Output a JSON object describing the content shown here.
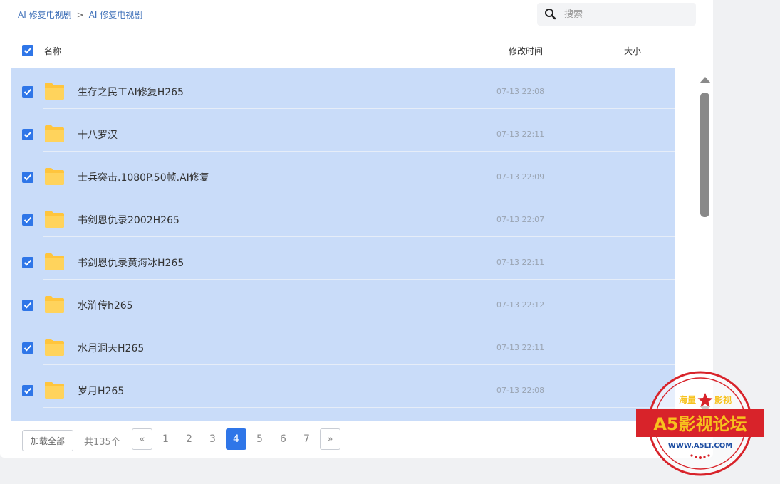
{
  "breadcrumb": {
    "root": "AI 修复电视剧",
    "separator": ">",
    "current": "AI 修复电视剧"
  },
  "search": {
    "placeholder": "搜索",
    "value": ""
  },
  "columns": {
    "name": "名称",
    "modified": "修改时间",
    "size": "大小"
  },
  "rows": [
    {
      "name": "生存之民工AI修复H265",
      "time": "07-13 22:08"
    },
    {
      "name": "十八罗汉",
      "time": "07-13 22:11"
    },
    {
      "name": "士兵突击.1080P.50帧.AI修复",
      "time": "07-13 22:09"
    },
    {
      "name": "书剑恩仇录2002H265",
      "time": "07-13 22:07"
    },
    {
      "name": "书剑恩仇录黄海冰H265",
      "time": "07-13 22:11"
    },
    {
      "name": "水浒传h265",
      "time": "07-13 22:12"
    },
    {
      "name": "水月洞天H265",
      "time": "07-13 22:11"
    },
    {
      "name": "岁月H265",
      "time": "07-13 22:08"
    }
  ],
  "footer": {
    "load_all": "加载全部",
    "total": "共135个",
    "prev": "«",
    "next": "»",
    "pages": [
      "1",
      "2",
      "3",
      "4",
      "5",
      "6",
      "7"
    ],
    "current_page": "4"
  },
  "stamp": {
    "top_left": "海量",
    "top_right": "影视",
    "main": "A5影视论坛",
    "url": "WWW.A5LT.COM"
  },
  "colors": {
    "accent": "#2f76e8",
    "selection": "#c9dcf9",
    "folder": "#ffc53d",
    "stamp_red": "#d8232a",
    "stamp_gold": "#f7c21d"
  },
  "icons": {
    "search": "search-icon",
    "folder": "folder-icon",
    "check": "checkbox-checked-icon"
  }
}
